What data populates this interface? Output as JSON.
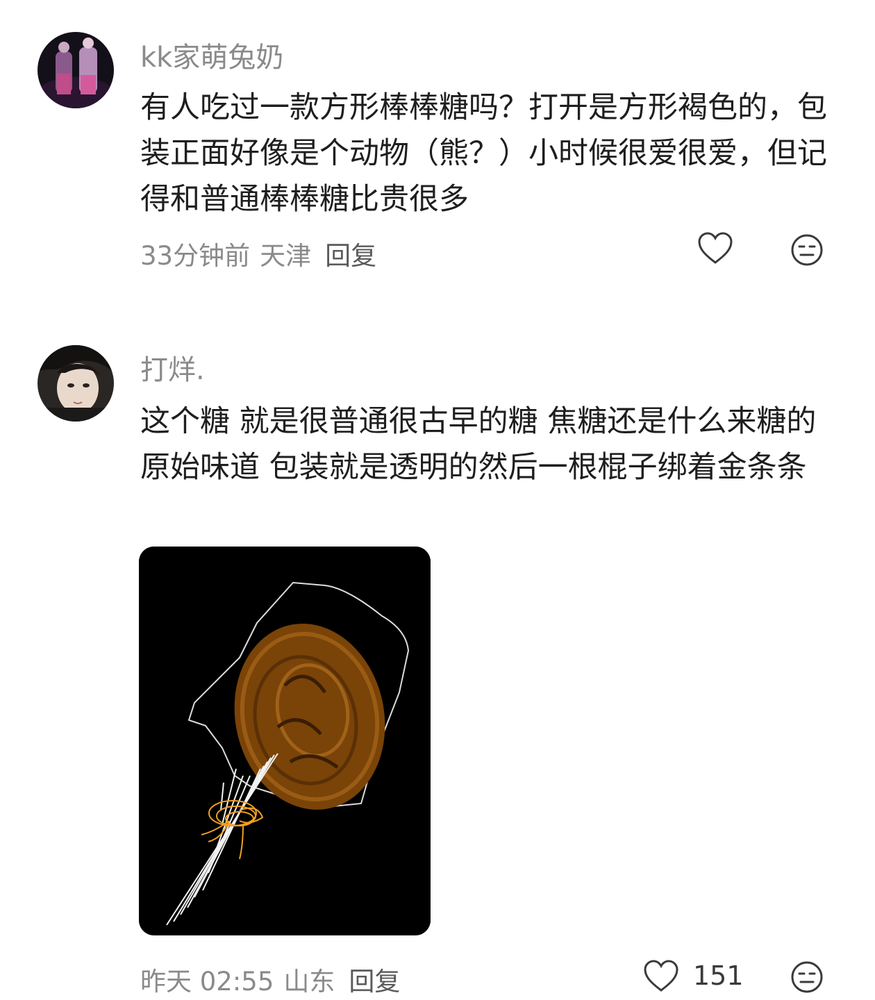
{
  "comments": [
    {
      "username": "kk家萌兔奶",
      "text": "有人吃过一款方形棒棒糖吗？打开是方形褐色的，包装正面好像是个动物（熊？）小时候很爱很爱，但记得和普通棒棒糖比贵很多",
      "time": "33分钟前",
      "location": "天津",
      "reply_label": "回复",
      "like_count": ""
    },
    {
      "username": "打烊.",
      "text": "这个糖 就是很普通很古早的糖 焦糖还是什么来糖的原始味道 包装就是透明的然后一根棍子绑着金条条",
      "time": "昨天 02:55",
      "location": "山东",
      "reply_label": "回复",
      "like_count": "151"
    }
  ],
  "icons": {
    "like": "heart-outline-icon",
    "dislike": "neutral-face-icon"
  },
  "colors": {
    "meta_gray": "#8a8a8a",
    "candy_brown": "#8a4f0c",
    "wrapper_gold": "#f0a020"
  }
}
